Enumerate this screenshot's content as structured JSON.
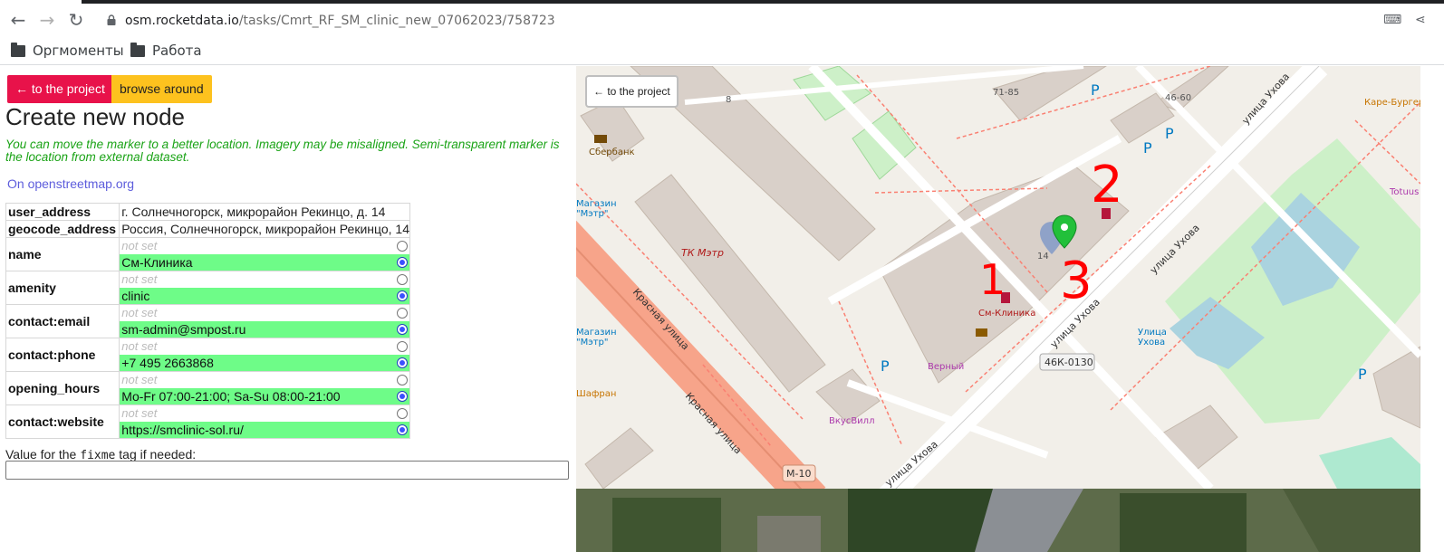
{
  "browser": {
    "url_host": "osm.rocketdata.io",
    "url_path": "/tasks/Cmrt_RF_SM_clinic_new_07062023/758723",
    "bookmarks": [
      {
        "label": "Оргмоменты"
      },
      {
        "label": "Работа"
      }
    ]
  },
  "panel": {
    "back_label": "← to the project",
    "browse_label": "browse around",
    "title": "Create new node",
    "hint": "You can move the marker to a better location. Imagery may be misaligned. Semi-transparent marker is the location from external dataset.",
    "osm_link": "On openstreetmap.org",
    "fixme_prefix": "Value for the ",
    "fixme_tag": "fixme",
    "fixme_suffix": " tag if needed:",
    "fixme_value": ""
  },
  "tags": {
    "user_address": {
      "key": "user_address",
      "value": "г. Солнечногорск, микрорайон Рекинцо, д. 14"
    },
    "geocode_address": {
      "key": "geocode_address",
      "value": "Россия, Солнечногорск, микрорайон Рекинцо, 14"
    },
    "not_set": "not set",
    "name": {
      "key": "name",
      "value": "См-Клиника"
    },
    "amenity": {
      "key": "amenity",
      "value": "clinic"
    },
    "email": {
      "key": "contact:email",
      "value": "sm-admin@smpost.ru"
    },
    "phone": {
      "key": "contact:phone",
      "value": "+7 495 2663868"
    },
    "hours": {
      "key": "opening_hours",
      "value": "Mo-Fr 07:00-21:00; Sa-Su 08:00-21:00"
    },
    "website": {
      "key": "contact:website",
      "value": "https://smclinic-sol.ru/"
    }
  },
  "map": {
    "back_label": "← to the project",
    "labels": {
      "sberbank": "Сбербанк",
      "tk_metr": "ТК Мэтр",
      "magazin_metr_1": "Магазин",
      "magazin_metr_1b": "\"Мэтр\"",
      "magazin_metr_2": "Магазин",
      "magazin_metr_2b": "\"Мэтр\"",
      "krasnaya_1": "Красная улица",
      "krasnaya_2": "Красная улица",
      "ukhova_1": "улица Ухова",
      "ukhova_2": "улица Ухова",
      "ukhova_3": "улица Ухова",
      "ukhova_4": "улица Ухова",
      "stop_ukhova_1": "Улица",
      "stop_ukhova_2": "Ухова",
      "sm_clinic": "См-Клиника",
      "verny": "Верный",
      "vkusvill": "ВкусВилл",
      "shafran": "Шафран",
      "kare_burger": "Каре-Бургер",
      "totuus": "Totuus",
      "road_46k": "46К-0130",
      "road_m10": "М-10",
      "house_8": "8",
      "house_7185": "71-85",
      "house_4660": "46-60",
      "house_14": "14",
      "parking": "P",
      "annot_1": "1",
      "annot_2": "2",
      "annot_3": "3"
    },
    "colors": {
      "background": "#f2efe9",
      "building": "#d9d0c9",
      "road_primary": "#fcd6a4",
      "road_red": "#f7a48a",
      "park": "#cdf0c8",
      "water": "#aad3df",
      "marker_green": "#22c03a",
      "marker_blue": "#6f8fc7",
      "annotation_red": "#ff0000"
    }
  }
}
